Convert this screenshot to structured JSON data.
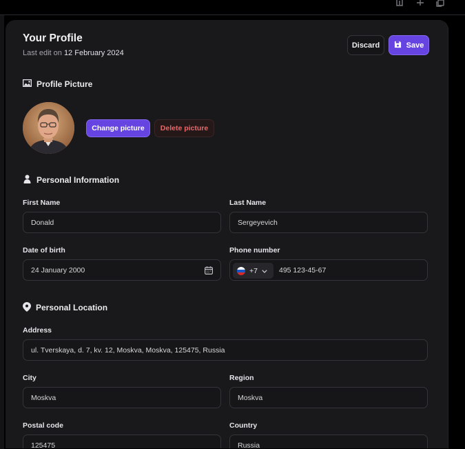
{
  "profile": {
    "title": "Your Profile",
    "last_edit_prefix": "Last edit on",
    "last_edit_date": "12 February 2024",
    "discard_label": "Discard",
    "save_label": "Save"
  },
  "picture": {
    "heading": "Profile Picture",
    "change_label": "Change picture",
    "delete_label": "Delete picture"
  },
  "personal": {
    "heading": "Personal Information",
    "first_name": {
      "label": "First Name",
      "value": "Donald"
    },
    "last_name": {
      "label": "Last Name",
      "value": "Sergeyevich"
    },
    "dob": {
      "label": "Date of birth",
      "value": "24 January 2000"
    },
    "phone": {
      "label": "Phone number",
      "code": "+7",
      "value": "495 123-45-67"
    }
  },
  "location": {
    "heading": "Personal Location",
    "address": {
      "label": "Address",
      "value": "ul. Tverskaya, d. 7, kv. 12, Moskva, Moskva, 125475, Russia"
    },
    "city": {
      "label": "City",
      "value": "Moskva"
    },
    "region": {
      "label": "Region",
      "value": "Moskva"
    },
    "postal": {
      "label": "Postal code",
      "value": "125475"
    },
    "country": {
      "label": "Country",
      "value": "Russia"
    }
  },
  "colors": {
    "accent": "#6644e2",
    "danger": "#e8686a",
    "panel": "#19191c",
    "field": "#161618"
  },
  "icons": [
    "share-icon",
    "plus-icon",
    "copy-icon",
    "save-icon",
    "image-icon",
    "user-icon",
    "map-pin-icon",
    "calendar-icon",
    "chevron-down-icon",
    "russia-flag-icon"
  ]
}
